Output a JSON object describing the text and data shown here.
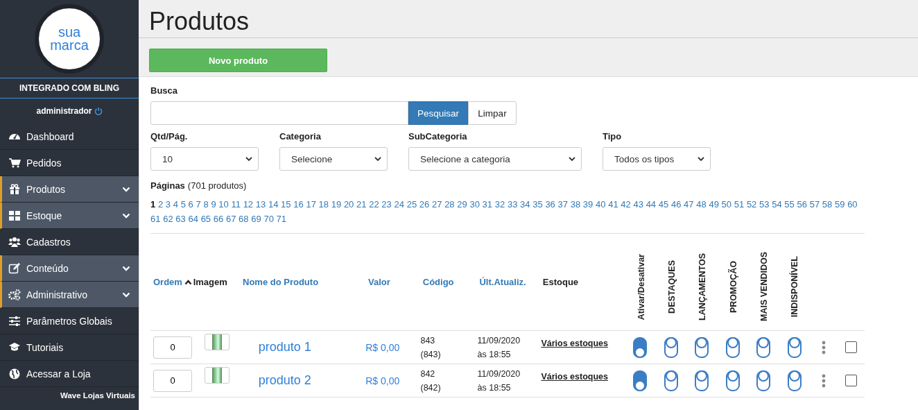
{
  "sidebar": {
    "logo": [
      "sua",
      "marca"
    ],
    "integration": "INTEGRADO COM BLING",
    "user": "administrador",
    "items": [
      {
        "label": "Dashboard",
        "kind": "link"
      },
      {
        "label": "Pedidos",
        "kind": "link"
      },
      {
        "label": "Produtos",
        "kind": "group"
      },
      {
        "label": "Estoque",
        "kind": "group"
      },
      {
        "label": "Cadastros",
        "kind": "link"
      },
      {
        "label": "Conteúdo",
        "kind": "group"
      },
      {
        "label": "Administrativo",
        "kind": "group"
      },
      {
        "label": "Parâmetros Globais",
        "kind": "link"
      },
      {
        "label": "Tutoriais",
        "kind": "link"
      },
      {
        "label": "Acessar a Loja",
        "kind": "link"
      }
    ],
    "footer": "Wave Lojas Virtuais"
  },
  "page_title": "Produtos",
  "new_button": "Novo produto",
  "search": {
    "label": "Busca",
    "search_button": "Pesquisar",
    "clear_button": "Limpar"
  },
  "filters": [
    {
      "label": "Qtd/Pág.",
      "value": "10"
    },
    {
      "label": "Categoria",
      "value": "Selecione"
    },
    {
      "label": "SubCategoria",
      "value": "Selecione a categoria"
    },
    {
      "label": "Tipo",
      "value": "Todos os tipos"
    }
  ],
  "pagination": {
    "label": "Páginas",
    "count": "(701 produtos)",
    "pages": [
      {
        "label": "1",
        "selected": true
      },
      {
        "label": "2",
        "selected": false
      },
      {
        "label": "3",
        "selected": false
      },
      {
        "label": "4",
        "selected": false
      },
      {
        "label": "5",
        "selected": false
      },
      {
        "label": "6",
        "selected": false
      },
      {
        "label": "7",
        "selected": false
      },
      {
        "label": "8",
        "selected": false
      },
      {
        "label": "9",
        "selected": false
      },
      {
        "label": "10",
        "selected": false
      },
      {
        "label": "11",
        "selected": false
      },
      {
        "label": "12",
        "selected": false
      },
      {
        "label": "13",
        "selected": false
      },
      {
        "label": "14",
        "selected": false
      },
      {
        "label": "15",
        "selected": false
      },
      {
        "label": "16",
        "selected": false
      },
      {
        "label": "17",
        "selected": false
      },
      {
        "label": "18",
        "selected": false
      },
      {
        "label": "19",
        "selected": false
      },
      {
        "label": "20",
        "selected": false
      },
      {
        "label": "21",
        "selected": false
      },
      {
        "label": "22",
        "selected": false
      },
      {
        "label": "23",
        "selected": false
      },
      {
        "label": "24",
        "selected": false
      },
      {
        "label": "25",
        "selected": false
      },
      {
        "label": "26",
        "selected": false
      },
      {
        "label": "27",
        "selected": false
      },
      {
        "label": "28",
        "selected": false
      },
      {
        "label": "29",
        "selected": false
      },
      {
        "label": "30",
        "selected": false
      },
      {
        "label": "31",
        "selected": false
      },
      {
        "label": "32",
        "selected": false
      },
      {
        "label": "33",
        "selected": false
      },
      {
        "label": "34",
        "selected": false
      },
      {
        "label": "35",
        "selected": false
      },
      {
        "label": "36",
        "selected": false
      },
      {
        "label": "37",
        "selected": false
      },
      {
        "label": "38",
        "selected": false
      },
      {
        "label": "39",
        "selected": false
      },
      {
        "label": "40",
        "selected": false
      },
      {
        "label": "41",
        "selected": false
      },
      {
        "label": "42",
        "selected": false
      },
      {
        "label": "43",
        "selected": false
      },
      {
        "label": "44",
        "selected": false
      },
      {
        "label": "45",
        "selected": false
      },
      {
        "label": "46",
        "selected": false
      },
      {
        "label": "47",
        "selected": false
      },
      {
        "label": "48",
        "selected": false
      },
      {
        "label": "49",
        "selected": false
      },
      {
        "label": "50",
        "selected": false
      },
      {
        "label": "51",
        "selected": false
      },
      {
        "label": "52",
        "selected": false
      },
      {
        "label": "53",
        "selected": false
      },
      {
        "label": "54",
        "selected": false
      },
      {
        "label": "55",
        "selected": false
      },
      {
        "label": "56",
        "selected": false
      },
      {
        "label": "57",
        "selected": false
      },
      {
        "label": "58",
        "selected": false
      },
      {
        "label": "59",
        "selected": false
      },
      {
        "label": "60",
        "selected": false
      },
      {
        "label": "61",
        "selected": false
      },
      {
        "label": "62",
        "selected": false
      },
      {
        "label": "63",
        "selected": false
      },
      {
        "label": "64",
        "selected": false
      },
      {
        "label": "65",
        "selected": false
      },
      {
        "label": "66",
        "selected": false
      },
      {
        "label": "67",
        "selected": false
      },
      {
        "label": "68",
        "selected": false
      },
      {
        "label": "69",
        "selected": false
      },
      {
        "label": "70",
        "selected": false
      },
      {
        "label": "71",
        "selected": false
      }
    ]
  },
  "table": {
    "columns": [
      {
        "label": "Ordem",
        "kind": "link",
        "sorted": true
      },
      {
        "label": "Imagem",
        "kind": "plain"
      },
      {
        "label": "Nome do Produto",
        "kind": "link"
      },
      {
        "label": "Valor",
        "kind": "link"
      },
      {
        "label": "Código",
        "kind": "link"
      },
      {
        "label": "Últ.Atualiz.",
        "kind": "link"
      },
      {
        "label": "Estoque",
        "kind": "plain"
      },
      {
        "label": "Ativar/Desativar",
        "kind": "rotated"
      },
      {
        "label": "DESTAQUES",
        "kind": "rotated"
      },
      {
        "label": "LANÇAMENTOS",
        "kind": "rotated"
      },
      {
        "label": "PROMOÇÃO",
        "kind": "rotated"
      },
      {
        "label": "MAIS VENDIDOS",
        "kind": "rotated"
      },
      {
        "label": "INDISPONÍVEL",
        "kind": "rotated"
      }
    ],
    "rows": [
      {
        "order": "0",
        "name": "produto 1",
        "price": "R$ 0,00",
        "code": "843",
        "code_ref": "(843)",
        "date": "11/09/2020",
        "time": "às 18:55",
        "stock": "Vários estoques",
        "toggles": [
          true,
          false,
          false,
          false,
          false,
          false
        ],
        "checked": false
      },
      {
        "order": "0",
        "name": "produto 2",
        "price": "R$ 0,00",
        "code": "842",
        "code_ref": "(842)",
        "date": "11/09/2020",
        "time": "às 18:55",
        "stock": "Vários estoques",
        "toggles": [
          true,
          false,
          false,
          false,
          false,
          false
        ],
        "checked": false
      }
    ]
  }
}
